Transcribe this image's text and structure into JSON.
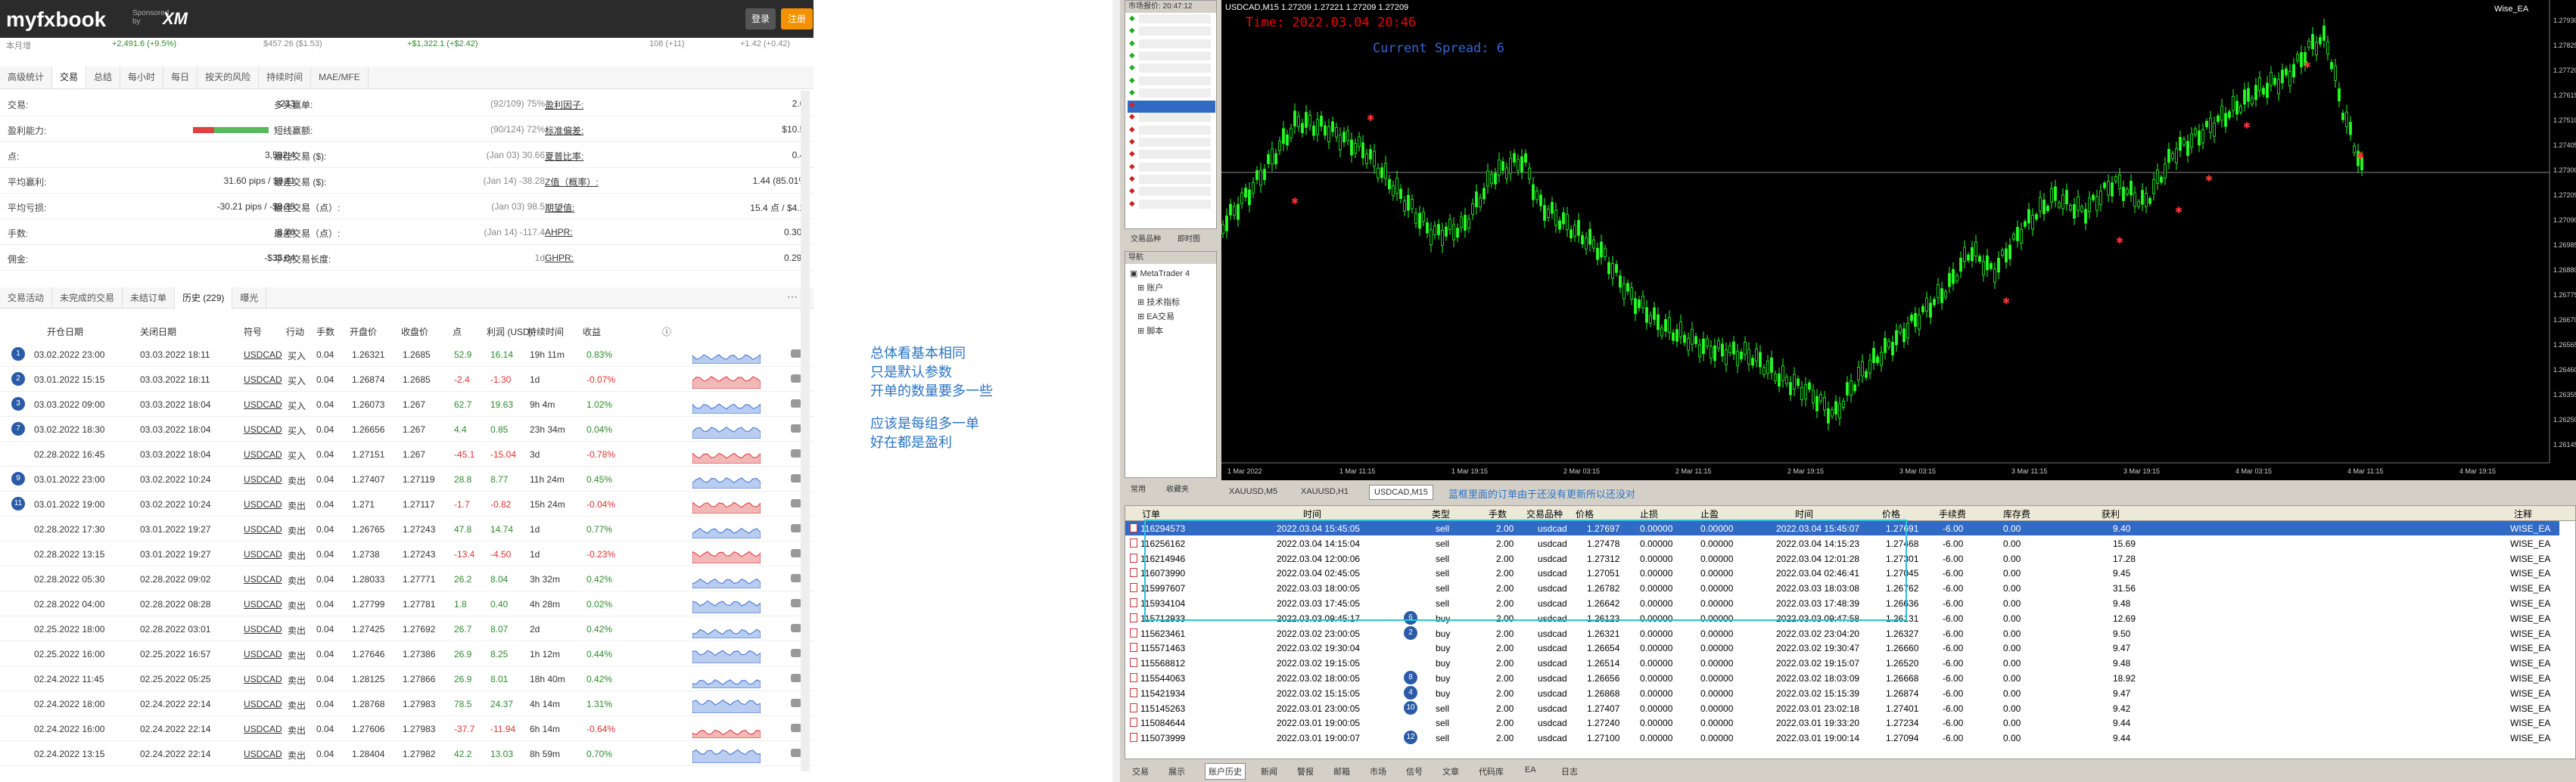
{
  "header": {
    "logo": "myfxbook",
    "sponsored": "Sponsored by",
    "broker": "XM",
    "login": "登录",
    "register": "注册",
    "sub_left": "本月增",
    "sub_vals": [
      "+2,491.6 (+9.5%)",
      "$457.26 ($1.53)",
      "+$1,322.1 (+$2.42)",
      "108 (+11)",
      "+1.42 (+0.42)"
    ]
  },
  "tabs1": [
    "高级统计",
    "交易",
    "总结",
    "每小时",
    "每日",
    "按天的风险",
    "持续时间",
    "MAE/MFE"
  ],
  "stats": [
    {
      "l1": "交易:",
      "v1": "233",
      "l2": "多头赢单:",
      "v2": "(92/109) 75%",
      "l3": "盈利因子:",
      "v3": "2.69"
    },
    {
      "l1": "盈利能力:",
      "v1": "",
      "l2": "短线赢额:",
      "v2": "(90/124) 72%",
      "l3": "标准偏差:",
      "v3": "$10.53"
    },
    {
      "l1": "点:",
      "v1": "3,592.4",
      "l2": "最佳交易 ($):",
      "v2": "(Jan 03) 30.66",
      "l3": "夏普比率:",
      "v3": "0.41"
    },
    {
      "l1": "平均赢利:",
      "v1": "31.60 pips / $9.11",
      "l2": "最差交易 ($):",
      "v2": "(Jan 14) -38.28",
      "l3": "Z值（概率）:",
      "v3": "1.44 (85.01%)"
    },
    {
      "l1": "平均亏损:",
      "v1": "-30.21 pips / -$9.35",
      "l2": "最佳交易（点）:",
      "v2": "(Jan 03) 98.5",
      "l3": "期望值:",
      "v3": "15.4 点 / $4.22"
    },
    {
      "l1": "手数:",
      "v1": "8.76",
      "l2": "最差交易（点）:",
      "v2": "(Jan 14) -117.4",
      "l3": "AHPR:",
      "v3": "0.30%"
    },
    {
      "l1": "佣金:",
      "v1": "-$35.04",
      "l2": "平均交易长度:",
      "v2": "1d",
      "l3": "GHPR:",
      "v3": "0.29%"
    }
  ],
  "tabs2": [
    "交易活动",
    "未完成的交易",
    "未结订单",
    "历史 (229)",
    "曝光"
  ],
  "table_headers": [
    "开仓日期",
    "关闭日期",
    "符号",
    "行动",
    "手数",
    "开盘价",
    "收盘价",
    "点",
    "利润 (USD)",
    "持续时间",
    "收益"
  ],
  "trades": [
    {
      "n": "1",
      "open": "03.02.2022 23:00",
      "close": "03.03.2022 18:11",
      "sym": "USDCAD",
      "act": "买入",
      "lots": "0.04",
      "op": "1.26321",
      "cp": "1.2685",
      "pips": "52.9",
      "profit": "16.14",
      "dur": "19h 11m",
      "gain": "0.83%"
    },
    {
      "n": "2",
      "open": "03.01.2022 15:15",
      "close": "03.03.2022 18:11",
      "sym": "USDCAD",
      "act": "买入",
      "lots": "0.04",
      "op": "1.26874",
      "cp": "1.2685",
      "pips": "-2.4",
      "profit": "-1.30",
      "dur": "1d",
      "gain": "-0.07%"
    },
    {
      "n": "3",
      "open": "03.03.2022 09:00",
      "close": "03.03.2022 18:04",
      "sym": "USDCAD",
      "act": "买入",
      "lots": "0.04",
      "op": "1.26073",
      "cp": "1.267",
      "pips": "62.7",
      "profit": "19.63",
      "dur": "9h 4m",
      "gain": "1.02%"
    },
    {
      "n": "7",
      "open": "03.02.2022 18:30",
      "close": "03.03.2022 18:04",
      "sym": "USDCAD",
      "act": "买入",
      "lots": "0.04",
      "op": "1.26656",
      "cp": "1.267",
      "pips": "4.4",
      "profit": "0.85",
      "dur": "23h 34m",
      "gain": "0.04%"
    },
    {
      "n": "",
      "open": "02.28.2022 16:45",
      "close": "03.03.2022 18:04",
      "sym": "USDCAD",
      "act": "买入",
      "lots": "0.04",
      "op": "1.27151",
      "cp": "1.267",
      "pips": "-45.1",
      "profit": "-15.04",
      "dur": "3d",
      "gain": "-0.78%"
    },
    {
      "n": "9",
      "open": "03.01.2022 23:00",
      "close": "03.02.2022 10:24",
      "sym": "USDCAD",
      "act": "卖出",
      "lots": "0.04",
      "op": "1.27407",
      "cp": "1.27119",
      "pips": "28.8",
      "profit": "8.77",
      "dur": "11h 24m",
      "gain": "0.45%"
    },
    {
      "n": "11",
      "open": "03.01.2022 19:00",
      "close": "03.02.2022 10:24",
      "sym": "USDCAD",
      "act": "卖出",
      "lots": "0.04",
      "op": "1.271",
      "cp": "1.27117",
      "pips": "-1.7",
      "profit": "-0.82",
      "dur": "15h 24m",
      "gain": "-0.04%"
    },
    {
      "n": "",
      "open": "02.28.2022 17:30",
      "close": "03.01.2022 19:27",
      "sym": "USDCAD",
      "act": "卖出",
      "lots": "0.04",
      "op": "1.26765",
      "cp": "1.27243",
      "pips": "47.8",
      "profit": "14.74",
      "dur": "1d",
      "gain": "0.77%"
    },
    {
      "n": "",
      "open": "02.28.2022 13:15",
      "close": "03.01.2022 19:27",
      "sym": "USDCAD",
      "act": "卖出",
      "lots": "0.04",
      "op": "1.2738",
      "cp": "1.27243",
      "pips": "-13.4",
      "profit": "-4.50",
      "dur": "1d",
      "gain": "-0.23%"
    },
    {
      "n": "",
      "open": "02.28.2022 05:30",
      "close": "02.28.2022 09:02",
      "sym": "USDCAD",
      "act": "卖出",
      "lots": "0.04",
      "op": "1.28033",
      "cp": "1.27771",
      "pips": "26.2",
      "profit": "8.04",
      "dur": "3h 32m",
      "gain": "0.42%"
    },
    {
      "n": "",
      "open": "02.28.2022 04:00",
      "close": "02.28.2022 08:28",
      "sym": "USDCAD",
      "act": "卖出",
      "lots": "0.04",
      "op": "1.27799",
      "cp": "1.27781",
      "pips": "1.8",
      "profit": "0.40",
      "dur": "4h 28m",
      "gain": "0.02%"
    },
    {
      "n": "",
      "open": "02.25.2022 18:00",
      "close": "02.28.2022 03:01",
      "sym": "USDCAD",
      "act": "卖出",
      "lots": "0.04",
      "op": "1.27425",
      "cp": "1.27692",
      "pips": "26.7",
      "profit": "8.07",
      "dur": "2d",
      "gain": "0.42%"
    },
    {
      "n": "",
      "open": "02.25.2022 16:00",
      "close": "02.25.2022 16:57",
      "sym": "USDCAD",
      "act": "卖出",
      "lots": "0.04",
      "op": "1.27646",
      "cp": "1.27386",
      "pips": "26.9",
      "profit": "8.25",
      "dur": "1h 12m",
      "gain": "0.44%"
    },
    {
      "n": "",
      "open": "02.24.2022 11:45",
      "close": "02.25.2022 05:25",
      "sym": "USDCAD",
      "act": "卖出",
      "lots": "0.04",
      "op": "1.28125",
      "cp": "1.27866",
      "pips": "26.9",
      "profit": "8.01",
      "dur": "18h 40m",
      "gain": "0.42%"
    },
    {
      "n": "",
      "open": "02.24.2022 18:00",
      "close": "02.24.2022 22:14",
      "sym": "USDCAD",
      "act": "卖出",
      "lots": "0.04",
      "op": "1.28768",
      "cp": "1.27983",
      "pips": "78.5",
      "profit": "24.37",
      "dur": "4h 14m",
      "gain": "1.31%"
    },
    {
      "n": "",
      "open": "02.24.2022 16:00",
      "close": "02.24.2022 22:14",
      "sym": "USDCAD",
      "act": "卖出",
      "lots": "0.04",
      "op": "1.27606",
      "cp": "1.27983",
      "pips": "-37.7",
      "profit": "-11.94",
      "dur": "6h 14m",
      "gain": "-0.64%"
    },
    {
      "n": "",
      "open": "02.24.2022 13:15",
      "close": "02.24.2022 22:14",
      "sym": "USDCAD",
      "act": "卖出",
      "lots": "0.04",
      "op": "1.28404",
      "cp": "1.27982",
      "pips": "42.2",
      "profit": "13.03",
      "dur": "8h 59m",
      "gain": "0.70%"
    }
  ],
  "note": [
    "总体看基本相同",
    "只是默认参数",
    "开单的数量要多一些",
    "应该是每组多一单",
    "好在都是盈利"
  ],
  "mt4": {
    "mw_title": "市场报价: 20:47:12",
    "nav_title": "导航",
    "nav_items": [
      "MetaTrader 4",
      "账户",
      "技术指标",
      "EA交易",
      "脚本"
    ],
    "mw_tabs": [
      "交易品种",
      "即时图"
    ],
    "nav_tabs": [
      "常用",
      "收藏夹"
    ],
    "chart_title": "USDCAD,M15  1.27209 1.27221 1.27209 1.27209",
    "chart_ea": "Wise_EA",
    "time_text": "Time: 2022.03.04 20:46",
    "spread_text": "Current Spread: 6",
    "chart_tabs": [
      "XAUUSD,M5",
      "XAUUSD,H1",
      "USDCAD,M15"
    ],
    "ylabels": [
      "1.27930",
      "1.27825",
      "1.27720",
      "1.27615",
      "1.27510",
      "1.27405",
      "1.27300",
      "1.27209",
      "1.27090",
      "1.26985",
      "1.26880",
      "1.26775",
      "1.26670",
      "1.26565",
      "1.26460",
      "1.26355",
      "1.26250",
      "1.26145"
    ],
    "xlabels": [
      "1 Mar 2022",
      "1 Mar 11:15",
      "1 Mar 19:15",
      "2 Mar 03:15",
      "2 Mar 11:15",
      "2 Mar 19:15",
      "3 Mar 03:15",
      "3 Mar 11:15",
      "3 Mar 19:15",
      "4 Mar 03:15",
      "4 Mar 11:15",
      "4 Mar 19:15"
    ],
    "term_note": "蓝框里面的订单由于还没有更新所以还没对",
    "term_headers": [
      "订单",
      "时间",
      "类型",
      "手数",
      "交易品种",
      "价格",
      "止损",
      "止盈",
      "时间",
      "价格",
      "手续费",
      "库存费",
      "获利",
      "注释"
    ],
    "orders": [
      {
        "id": "116294573",
        "t": "2022.03.04 15:45:05",
        "type": "sell",
        "lots": "2.00",
        "sym": "usdcad",
        "p": "1.27697",
        "sl": "0.00000",
        "tp": "0.00000",
        "ct": "2022.03.04 15:45:07",
        "cp": "1.27691",
        "fee": "-6.00",
        "swap": "0.00",
        "profit": "9.40",
        "c": "WISE_EA"
      },
      {
        "id": "116256162",
        "t": "2022.03.04 14:15:04",
        "type": "sell",
        "lots": "2.00",
        "sym": "usdcad",
        "p": "1.27478",
        "sl": "0.00000",
        "tp": "0.00000",
        "ct": "2022.03.04 14:15:23",
        "cp": "1.27468",
        "fee": "-6.00",
        "swap": "0.00",
        "profit": "15.69",
        "c": "WISE_EA"
      },
      {
        "id": "116214946",
        "t": "2022.03.04 12:00:06",
        "type": "sell",
        "lots": "2.00",
        "sym": "usdcad",
        "p": "1.27312",
        "sl": "0.00000",
        "tp": "0.00000",
        "ct": "2022.03.04 12:01:28",
        "cp": "1.27301",
        "fee": "-6.00",
        "swap": "0.00",
        "profit": "17.28",
        "c": "WISE_EA"
      },
      {
        "id": "116073990",
        "t": "2022.03.04 02:45:05",
        "type": "sell",
        "lots": "2.00",
        "sym": "usdcad",
        "p": "1.27051",
        "sl": "0.00000",
        "tp": "0.00000",
        "ct": "2022.03.04 02:46:41",
        "cp": "1.27045",
        "fee": "-6.00",
        "swap": "0.00",
        "profit": "9.45",
        "c": "WISE_EA"
      },
      {
        "id": "115997607",
        "t": "2022.03.03 18:00:05",
        "type": "sell",
        "lots": "2.00",
        "sym": "usdcad",
        "p": "1.26782",
        "sl": "0.00000",
        "tp": "0.00000",
        "ct": "2022.03.03 18:03:08",
        "cp": "1.26762",
        "fee": "-6.00",
        "swap": "0.00",
        "profit": "31.56",
        "c": "WISE_EA"
      },
      {
        "id": "115934104",
        "t": "2022.03.03 17:45:05",
        "type": "sell",
        "lots": "2.00",
        "sym": "usdcad",
        "p": "1.26642",
        "sl": "0.00000",
        "tp": "0.00000",
        "ct": "2022.03.03 17:48:39",
        "cp": "1.26636",
        "fee": "-6.00",
        "swap": "0.00",
        "profit": "9.48",
        "c": "WISE_EA"
      },
      {
        "id": "115712933",
        "t": "2022.03.03 09:45:17",
        "type": "buy",
        "lots": "2.00",
        "sym": "usdcad",
        "p": "1.26123",
        "sl": "0.00000",
        "tp": "0.00000",
        "ct": "2022.03.03 09:47:58",
        "cp": "1.26131",
        "fee": "-6.00",
        "swap": "0.00",
        "profit": "12.69",
        "c": "WISE_EA",
        "b": "6"
      },
      {
        "id": "115623461",
        "t": "2022.03.02 23:00:05",
        "type": "buy",
        "lots": "2.00",
        "sym": "usdcad",
        "p": "1.26321",
        "sl": "0.00000",
        "tp": "0.00000",
        "ct": "2022.03.02 23:04:20",
        "cp": "1.26327",
        "fee": "-6.00",
        "swap": "0.00",
        "profit": "9.50",
        "c": "WISE_EA",
        "b": "2"
      },
      {
        "id": "115571463",
        "t": "2022.03.02 19:30:04",
        "type": "buy",
        "lots": "2.00",
        "sym": "usdcad",
        "p": "1.26654",
        "sl": "0.00000",
        "tp": "0.00000",
        "ct": "2022.03.02 19:30:47",
        "cp": "1.26660",
        "fee": "-6.00",
        "swap": "0.00",
        "profit": "9.47",
        "c": "WISE_EA"
      },
      {
        "id": "115568812",
        "t": "2022.03.02 19:15:05",
        "type": "buy",
        "lots": "2.00",
        "sym": "usdcad",
        "p": "1.26514",
        "sl": "0.00000",
        "tp": "0.00000",
        "ct": "2022.03.02 19:15:07",
        "cp": "1.26520",
        "fee": "-6.00",
        "swap": "0.00",
        "profit": "9.48",
        "c": "WISE_EA"
      },
      {
        "id": "115544063",
        "t": "2022.03.02 18:00:05",
        "type": "buy",
        "lots": "2.00",
        "sym": "usdcad",
        "p": "1.26656",
        "sl": "0.00000",
        "tp": "0.00000",
        "ct": "2022.03.02 18:03:09",
        "cp": "1.26668",
        "fee": "-6.00",
        "swap": "0.00",
        "profit": "18.92",
        "c": "WISE_EA",
        "b": "8"
      },
      {
        "id": "115421934",
        "t": "2022.03.02 15:15:05",
        "type": "buy",
        "lots": "2.00",
        "sym": "usdcad",
        "p": "1.26868",
        "sl": "0.00000",
        "tp": "0.00000",
        "ct": "2022.03.02 15:15:39",
        "cp": "1.26874",
        "fee": "-6.00",
        "swap": "0.00",
        "profit": "9.47",
        "c": "WISE_EA",
        "b": "4"
      },
      {
        "id": "115145263",
        "t": "2022.03.01 23:00:05",
        "type": "sell",
        "lots": "2.00",
        "sym": "usdcad",
        "p": "1.27407",
        "sl": "0.00000",
        "tp": "0.00000",
        "ct": "2022.03.01 23:02:18",
        "cp": "1.27401",
        "fee": "-6.00",
        "swap": "0.00",
        "profit": "9.42",
        "c": "WISE_EA",
        "b": "10"
      },
      {
        "id": "115084644",
        "t": "2022.03.01 19:00:05",
        "type": "sell",
        "lots": "2.00",
        "sym": "usdcad",
        "p": "1.27240",
        "sl": "0.00000",
        "tp": "0.00000",
        "ct": "2022.03.01 19:33:20",
        "cp": "1.27234",
        "fee": "-6.00",
        "swap": "0.00",
        "profit": "9.44",
        "c": "WISE_EA"
      },
      {
        "id": "115073999",
        "t": "2022.03.01 19:00:07",
        "type": "sell",
        "lots": "2.00",
        "sym": "usdcad",
        "p": "1.27100",
        "sl": "0.00000",
        "tp": "0.00000",
        "ct": "2022.03.01 19:00:14",
        "cp": "1.27094",
        "fee": "-6.00",
        "swap": "0.00",
        "profit": "9.44",
        "c": "WISE_EA",
        "b": "12"
      }
    ],
    "bottom_tabs": [
      "交易",
      "展示",
      "账户历史",
      "新闻",
      "警报",
      "邮箱",
      "市场",
      "信号",
      "文章",
      "代码库",
      "EA",
      "日志"
    ]
  }
}
